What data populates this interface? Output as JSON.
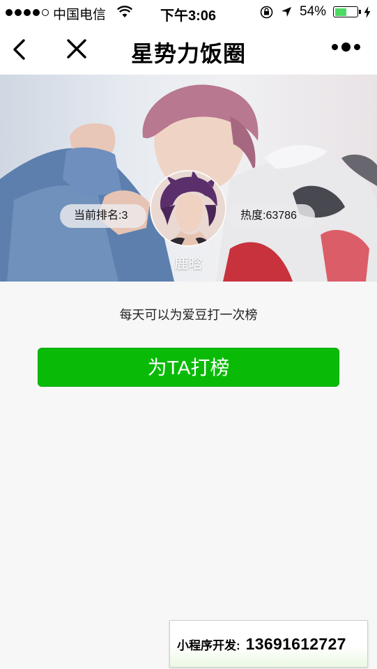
{
  "status_bar": {
    "carrier": "中国电信",
    "time": "下午3:06",
    "battery_text": "54%",
    "battery_level": 0.54,
    "signal_bars_filled": 4,
    "signal_bars_total": 5
  },
  "nav": {
    "title": "星势力饭圈",
    "back_icon": "chevron-left-icon",
    "close_icon": "close-icon",
    "more_icon": "more-dots-icon"
  },
  "hero": {
    "rank_label": "当前排名:3",
    "heat_label": "热度:63786",
    "idol_name": "鹿晗"
  },
  "main": {
    "hint_text": "每天可以为爱豆打一次榜",
    "vote_button_label": "为TA打榜"
  },
  "dev_contact": {
    "label": "小程序开发:",
    "phone": "13691612727"
  },
  "colors": {
    "accent_green": "#09bb07",
    "page_bg": "#f7f7f7",
    "battery_green": "#4cd964"
  }
}
